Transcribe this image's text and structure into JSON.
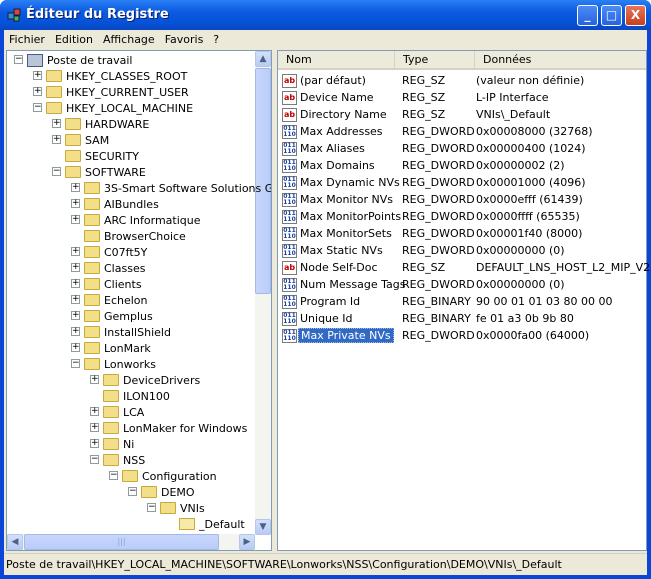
{
  "window": {
    "title": "Éditeur du Registre",
    "minimize": "_",
    "maximize": "□",
    "close": "X"
  },
  "menu": [
    {
      "label": "Fichier"
    },
    {
      "label": "Edition"
    },
    {
      "label": "Affichage"
    },
    {
      "label": "Favoris"
    },
    {
      "label": "?"
    }
  ],
  "tree": [
    {
      "label": "Poste de travail",
      "level": 0,
      "exp": "-",
      "icon": "computer"
    },
    {
      "label": "HKEY_CLASSES_ROOT",
      "level": 1,
      "exp": "+"
    },
    {
      "label": "HKEY_CURRENT_USER",
      "level": 1,
      "exp": "+"
    },
    {
      "label": "HKEY_LOCAL_MACHINE",
      "level": 1,
      "exp": "-"
    },
    {
      "label": "HARDWARE",
      "level": 2,
      "exp": "+"
    },
    {
      "label": "SAM",
      "level": 2,
      "exp": "+"
    },
    {
      "label": "SECURITY",
      "level": 2,
      "exp": ""
    },
    {
      "label": "SOFTWARE",
      "level": 2,
      "exp": "-"
    },
    {
      "label": "3S-Smart Software Solutions G",
      "level": 3,
      "exp": "+"
    },
    {
      "label": "AIBundles",
      "level": 3,
      "exp": "+"
    },
    {
      "label": "ARC Informatique",
      "level": 3,
      "exp": "+"
    },
    {
      "label": "BrowserChoice",
      "level": 3,
      "exp": ""
    },
    {
      "label": "C07ft5Y",
      "level": 3,
      "exp": "+"
    },
    {
      "label": "Classes",
      "level": 3,
      "exp": "+"
    },
    {
      "label": "Clients",
      "level": 3,
      "exp": "+"
    },
    {
      "label": "Echelon",
      "level": 3,
      "exp": "+"
    },
    {
      "label": "Gemplus",
      "level": 3,
      "exp": "+"
    },
    {
      "label": "InstallShield",
      "level": 3,
      "exp": "+"
    },
    {
      "label": "LonMark",
      "level": 3,
      "exp": "+"
    },
    {
      "label": "Lonworks",
      "level": 3,
      "exp": "-"
    },
    {
      "label": "DeviceDrivers",
      "level": 4,
      "exp": "+"
    },
    {
      "label": "ILON100",
      "level": 4,
      "exp": ""
    },
    {
      "label": "LCA",
      "level": 4,
      "exp": "+"
    },
    {
      "label": "LonMaker for Windows",
      "level": 4,
      "exp": "+"
    },
    {
      "label": "Ni",
      "level": 4,
      "exp": "+"
    },
    {
      "label": "NSS",
      "level": 4,
      "exp": "-"
    },
    {
      "label": "Configuration",
      "level": 5,
      "exp": "-"
    },
    {
      "label": "DEMO",
      "level": 6,
      "exp": "-"
    },
    {
      "label": "VNIs",
      "level": 7,
      "exp": "-"
    },
    {
      "label": "_Default",
      "level": 8,
      "exp": "",
      "open": true
    }
  ],
  "list": {
    "headers": {
      "name": "Nom",
      "type": "Type",
      "data": "Données"
    },
    "rows": [
      {
        "name": "(par défaut)",
        "type": "REG_SZ",
        "data": "(valeur non définie)",
        "icon": "string"
      },
      {
        "name": "Device Name",
        "type": "REG_SZ",
        "data": "L-IP Interface",
        "icon": "string"
      },
      {
        "name": "Directory Name",
        "type": "REG_SZ",
        "data": "VNIs\\_Default",
        "icon": "string"
      },
      {
        "name": "Max Addresses",
        "type": "REG_DWORD",
        "data": "0x00008000 (32768)",
        "icon": "binary"
      },
      {
        "name": "Max Aliases",
        "type": "REG_DWORD",
        "data": "0x00000400 (1024)",
        "icon": "binary"
      },
      {
        "name": "Max Domains",
        "type": "REG_DWORD",
        "data": "0x00000002 (2)",
        "icon": "binary"
      },
      {
        "name": "Max Dynamic NVs",
        "type": "REG_DWORD",
        "data": "0x00001000 (4096)",
        "icon": "binary"
      },
      {
        "name": "Max Monitor NVs",
        "type": "REG_DWORD",
        "data": "0x0000efff (61439)",
        "icon": "binary"
      },
      {
        "name": "Max MonitorPoints",
        "type": "REG_DWORD",
        "data": "0x0000ffff (65535)",
        "icon": "binary"
      },
      {
        "name": "Max MonitorSets",
        "type": "REG_DWORD",
        "data": "0x00001f40 (8000)",
        "icon": "binary"
      },
      {
        "name": "Max Static NVs",
        "type": "REG_DWORD",
        "data": "0x00000000 (0)",
        "icon": "binary"
      },
      {
        "name": "Node Self-Doc",
        "type": "REG_SZ",
        "data": "DEFAULT_LNS_HOST_L2_MIP_V2",
        "icon": "string"
      },
      {
        "name": "Num Message Tags",
        "type": "REG_DWORD",
        "data": "0x00000000 (0)",
        "icon": "binary"
      },
      {
        "name": "Program Id",
        "type": "REG_BINARY",
        "data": "90 00 01 01 03 80 00 00",
        "icon": "binary"
      },
      {
        "name": "Unique Id",
        "type": "REG_BINARY",
        "data": "fe 01 a3 0b 9b 80",
        "icon": "binary"
      },
      {
        "name": "Max Private NVs",
        "type": "REG_DWORD",
        "data": "0x0000fa00 (64000)",
        "icon": "binary",
        "selected": true
      }
    ]
  },
  "status": "Poste de travail\\HKEY_LOCAL_MACHINE\\SOFTWARE\\Lonworks\\NSS\\Configuration\\DEMO\\VNIs\\_Default"
}
